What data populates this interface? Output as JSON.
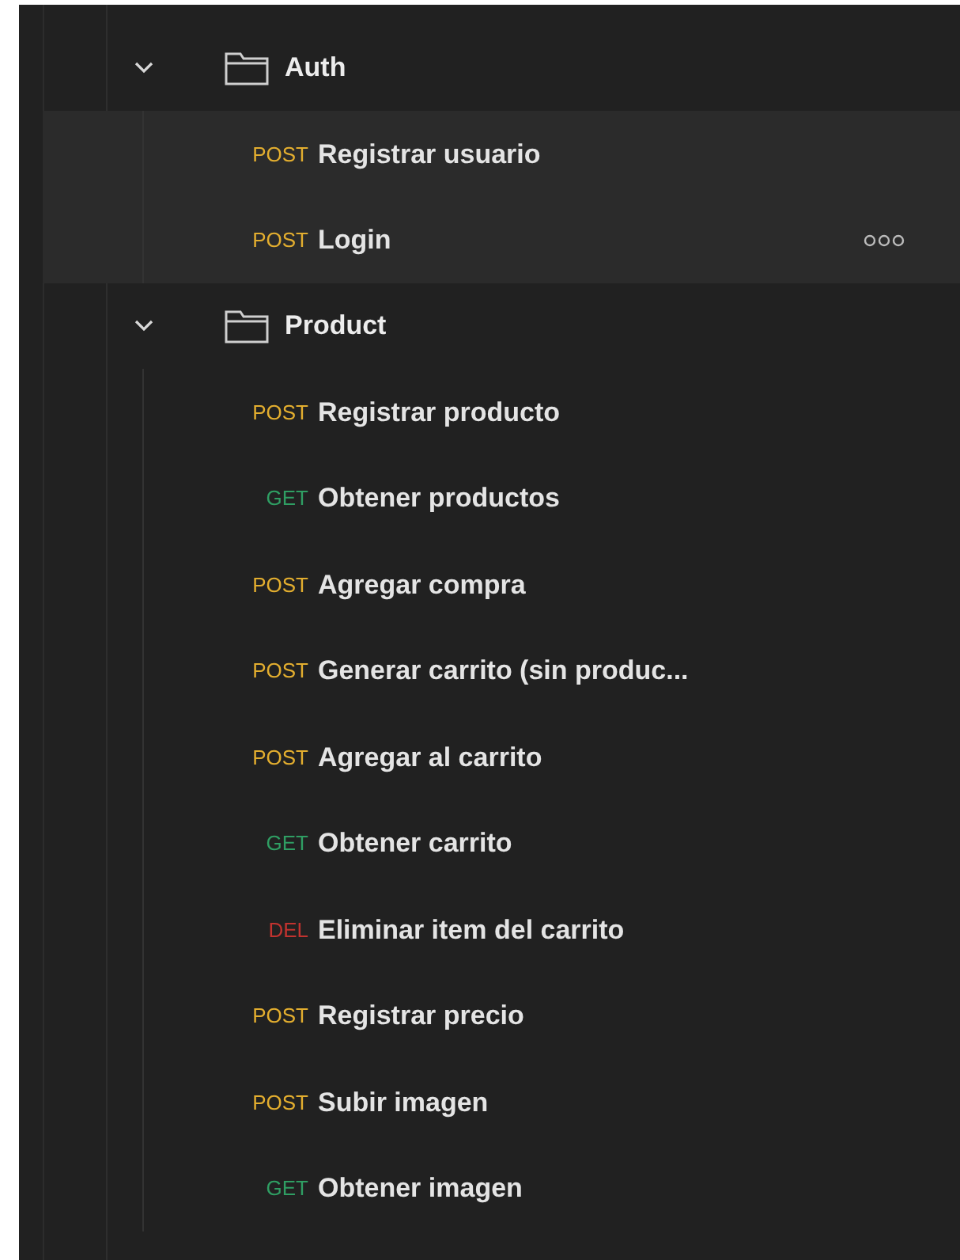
{
  "folders": [
    {
      "name": "Auth",
      "expanded": true,
      "highlighted": true,
      "requests": [
        {
          "method": "POST",
          "kind": "post",
          "name": "Registrar usuario",
          "hovered": false
        },
        {
          "method": "POST",
          "kind": "post",
          "name": "Login",
          "hovered": true
        }
      ]
    },
    {
      "name": "Product",
      "expanded": true,
      "highlighted": false,
      "requests": [
        {
          "method": "POST",
          "kind": "post",
          "name": "Registrar producto",
          "hovered": false
        },
        {
          "method": "GET",
          "kind": "get",
          "name": "Obtener productos",
          "hovered": false
        },
        {
          "method": "POST",
          "kind": "post",
          "name": "Agregar compra",
          "hovered": false
        },
        {
          "method": "POST",
          "kind": "post",
          "name": "Generar carrito (sin produc...",
          "hovered": false
        },
        {
          "method": "POST",
          "kind": "post",
          "name": "Agregar al carrito",
          "hovered": false
        },
        {
          "method": "GET",
          "kind": "get",
          "name": "Obtener carrito",
          "hovered": false
        },
        {
          "method": "DEL",
          "kind": "delete",
          "name": "Eliminar item del carrito",
          "hovered": false
        },
        {
          "method": "POST",
          "kind": "post",
          "name": "Registrar precio",
          "hovered": false
        },
        {
          "method": "POST",
          "kind": "post",
          "name": "Subir imagen",
          "hovered": false
        },
        {
          "method": "GET",
          "kind": "get",
          "name": "Obtener imagen",
          "hovered": false
        }
      ]
    }
  ]
}
